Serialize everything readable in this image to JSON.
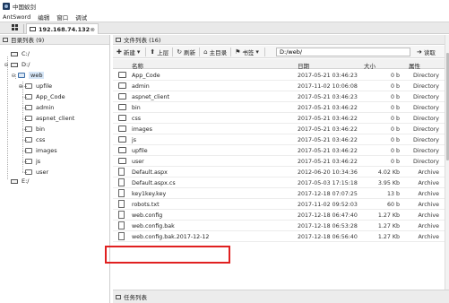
{
  "window": {
    "title": "中国蚁剑"
  },
  "menu": [
    "AntSword",
    "编辑",
    "窗口",
    "调试"
  ],
  "tab": {
    "label": "192.168.74.132",
    "close": "⊗"
  },
  "tree": {
    "header": "目录列表 (9)",
    "items": [
      {
        "label": "C:/",
        "icon": "drive"
      },
      {
        "label": "D:/",
        "icon": "drive",
        "toggle": "⊖"
      },
      {
        "label": "web",
        "icon": "folder",
        "toggle": "⊖",
        "selected": true
      },
      {
        "label": "upfile",
        "icon": "folder",
        "toggle": "⊕"
      },
      {
        "label": "App_Code",
        "icon": "folder"
      },
      {
        "label": "admin",
        "icon": "folder"
      },
      {
        "label": "aspnet_client",
        "icon": "folder"
      },
      {
        "label": "bin",
        "icon": "folder"
      },
      {
        "label": "css",
        "icon": "folder"
      },
      {
        "label": "images",
        "icon": "folder"
      },
      {
        "label": "js",
        "icon": "folder"
      },
      {
        "label": "user",
        "icon": "folder"
      },
      {
        "label": "E:/",
        "icon": "drive"
      }
    ]
  },
  "files": {
    "header": "文件列表 (16)",
    "toolbar": {
      "new": "新建",
      "up": "上层",
      "refresh": "刷新",
      "home": "主目录",
      "bookmark": "书签",
      "path": "D:/web/",
      "read": "读取"
    },
    "columns": {
      "name": "名称",
      "date": "日期",
      "size": "大小",
      "attr": "属性"
    },
    "rows": [
      {
        "type": "folder",
        "name": "App_Code",
        "date": "2017-05-21 03:46:23",
        "size": "0 b",
        "attr": "Directory"
      },
      {
        "type": "folder",
        "name": "admin",
        "date": "2017-11-02 10:06:08",
        "size": "0 b",
        "attr": "Directory"
      },
      {
        "type": "folder",
        "name": "aspnet_client",
        "date": "2017-05-21 03:46:23",
        "size": "0 b",
        "attr": "Directory"
      },
      {
        "type": "folder",
        "name": "bin",
        "date": "2017-05-21 03:46:22",
        "size": "0 b",
        "attr": "Directory"
      },
      {
        "type": "folder",
        "name": "css",
        "date": "2017-05-21 03:46:22",
        "size": "0 b",
        "attr": "Directory"
      },
      {
        "type": "folder",
        "name": "images",
        "date": "2017-05-21 03:46:22",
        "size": "0 b",
        "attr": "Directory"
      },
      {
        "type": "folder",
        "name": "js",
        "date": "2017-05-21 03:46:22",
        "size": "0 b",
        "attr": "Directory"
      },
      {
        "type": "folder",
        "name": "upfile",
        "date": "2017-05-21 03:46:22",
        "size": "0 b",
        "attr": "Directory"
      },
      {
        "type": "folder",
        "name": "user",
        "date": "2017-05-21 03:46:22",
        "size": "0 b",
        "attr": "Directory"
      },
      {
        "type": "file",
        "name": "Default.aspx",
        "date": "2012-06-20 10:34:36",
        "size": "4.02 Kb",
        "attr": "Archive"
      },
      {
        "type": "file",
        "name": "Default.aspx.cs",
        "date": "2017-05-03 17:15:18",
        "size": "3.95 Kb",
        "attr": "Archive"
      },
      {
        "type": "file",
        "name": "key1key.key",
        "date": "2017-12-18 07:07:25",
        "size": "13 b",
        "attr": "Archive"
      },
      {
        "type": "file",
        "name": "robots.txt",
        "date": "2017-11-02 09:52:03",
        "size": "60 b",
        "attr": "Archive"
      },
      {
        "type": "file",
        "name": "web.config",
        "date": "2017-12-18 06:47:40",
        "size": "1.27 Kb",
        "attr": "Archive"
      },
      {
        "type": "file",
        "name": "web.config.bak",
        "date": "2017-12-18 06:53:28",
        "size": "1.27 Kb",
        "attr": "Archive"
      },
      {
        "type": "file",
        "name": "web.config.bak.2017-12-12",
        "date": "2017-12-18 06:56:40",
        "size": "1.27 Kb",
        "attr": "Archive"
      }
    ]
  },
  "taskbar": {
    "label": "任务列表"
  },
  "colors": {
    "highlight": "#e02020",
    "selected": "#d6e6f7"
  }
}
